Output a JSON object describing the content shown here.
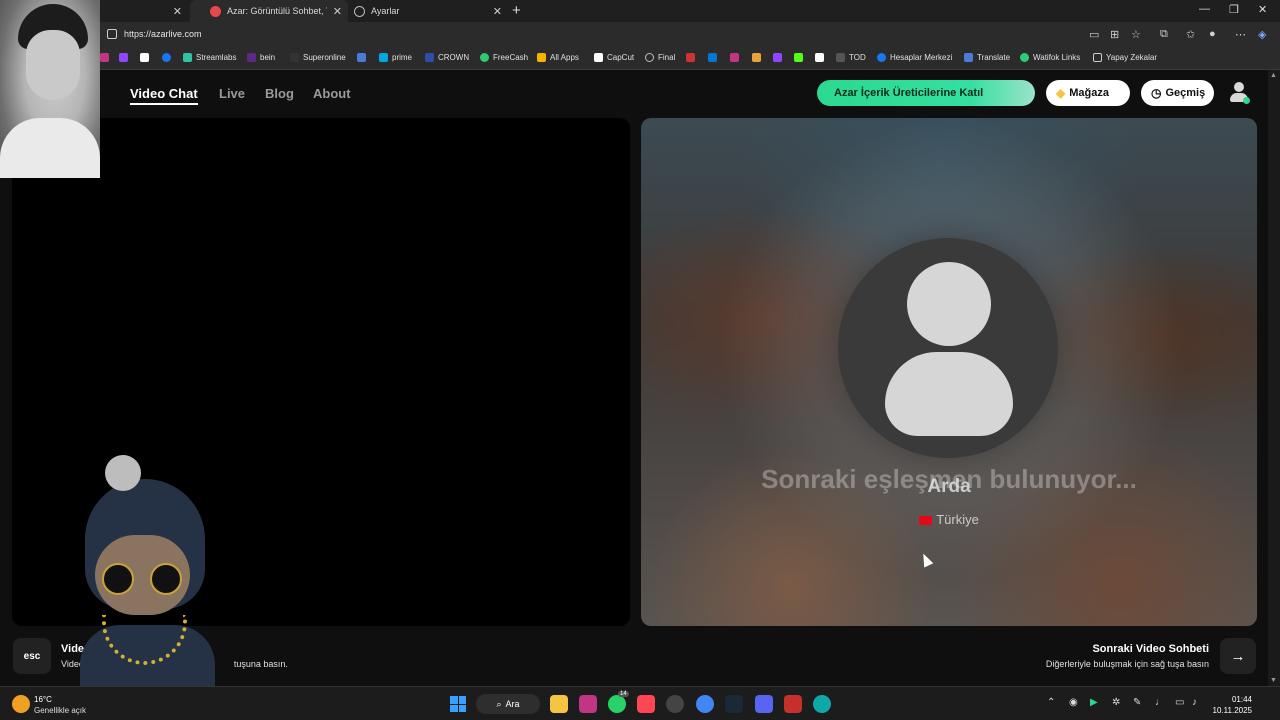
{
  "browser": {
    "tabs": [
      {
        "title": "Azar: Görüntülü Sohbet, Yen",
        "active": true,
        "color": "#e5484d"
      },
      {
        "title": "Ayarlar",
        "active": false,
        "color": "#9a9a9a"
      }
    ],
    "url": "https://azarlive.com",
    "bookmarks": [
      {
        "label": "",
        "color": "#c13584"
      },
      {
        "label": "",
        "color": "#9146ff"
      },
      {
        "label": "",
        "color": "#ffffff"
      },
      {
        "label": "",
        "color": "#1877f2"
      },
      {
        "label": "Streamlabs",
        "color": "#31c3a2"
      },
      {
        "label": "bein",
        "color": "#5b2a86"
      },
      {
        "label": "Superonline",
        "color": "#333333"
      },
      {
        "label": "",
        "color": "#4a7bd9"
      },
      {
        "label": "prime",
        "color": "#00a8e1"
      },
      {
        "label": "CROWN",
        "color": "#2b4ea8"
      },
      {
        "label": "FreeCash",
        "color": "#2ecc71"
      },
      {
        "label": "All Apps",
        "color": "#f4b400"
      },
      {
        "label": "CapCut",
        "color": "#ffffff"
      },
      {
        "label": "Final",
        "color": "#888888"
      },
      {
        "label": "",
        "color": "#cc3333"
      },
      {
        "label": "",
        "color": "#0078d4"
      },
      {
        "label": "",
        "color": "#c13584"
      },
      {
        "label": "",
        "color": "#e8a33d"
      },
      {
        "label": "",
        "color": "#9146ff"
      },
      {
        "label": "",
        "color": "#53fc18"
      },
      {
        "label": "",
        "color": "#ffffff"
      },
      {
        "label": "TOD",
        "color": "#222222"
      },
      {
        "label": "Hesaplar Merkezi",
        "color": "#1877f2"
      },
      {
        "label": "Translate",
        "color": "#4a7bd9"
      },
      {
        "label": "Watifok Links",
        "color": "#2ecc71"
      },
      {
        "label": "Yapay Zekalar",
        "color": "#cccccc"
      }
    ]
  },
  "nav": {
    "links": [
      "Video Chat",
      "Live",
      "Blog",
      "About"
    ],
    "creator_button": "Azar İçerik Üreticilerine Katıl",
    "shop_button": "Mağaza",
    "history_button": "Geçmiş"
  },
  "match": {
    "status": "Sonraki eşleşmen bulunuyor...",
    "name": "Arda",
    "country": "Türkiye"
  },
  "footer": {
    "esc_key": "esc",
    "left_title": "Vide",
    "left_desc_start": "Video",
    "left_desc_end": "tuşuna basın.",
    "right_title": "Sonraki Video Sohbeti",
    "right_desc": "Diğerleriyle buluşmak için sağ tuşa basın",
    "next_key": "→"
  },
  "taskbar": {
    "temp": "16°C",
    "condition": "Genellikle açık",
    "search": "Ara",
    "time": "01:44",
    "date": "10.11.2025",
    "whatsapp_badge": "14"
  },
  "colors": {
    "accent_green": "#2bd98f",
    "badge_red": "#e6365a"
  }
}
